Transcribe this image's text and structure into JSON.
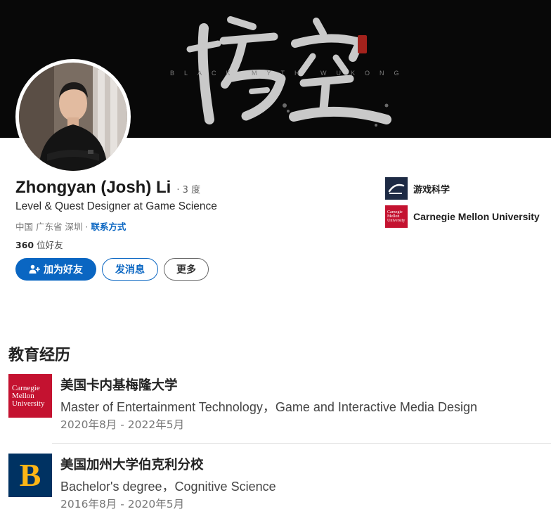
{
  "banner": {
    "subtitle": "BLACK MYTH WUKONG",
    "colors": {
      "background": "#080808",
      "brush": "#c9c9c9",
      "seal": "#a3221c"
    }
  },
  "profile": {
    "name": "Zhongyan (Josh) Li",
    "degree": "· 3 度",
    "headline": "Level & Quest Designer at Game Science",
    "location": "中国 广东省 深圳 ·",
    "contact_link": "联系方式",
    "connections_count": "360",
    "connections_label": "位好友"
  },
  "actions": {
    "connect": "加为好友",
    "message": "发消息",
    "more": "更多",
    "accent": "#0a66c2"
  },
  "orgs": [
    {
      "name": "游戏科学",
      "logo": "game-science-logo"
    },
    {
      "name": "Carnegie Mellon University",
      "logo": "cmu-logo"
    }
  ],
  "education": {
    "title": "教育经历",
    "items": [
      {
        "school": "美国卡内基梅隆大学",
        "degree": "Master of Entertainment Technology，Game and Interactive Media Design",
        "dates": "2020年8月 - 2022年5月",
        "logo_lines": [
          "Carnegie",
          "Mellon",
          "University"
        ]
      },
      {
        "school": "美国加州大学伯克利分校",
        "degree": "Bachelor's degree，Cognitive Science",
        "dates": "2016年8月 - 2020年5月",
        "logo_letter": "B"
      }
    ]
  }
}
